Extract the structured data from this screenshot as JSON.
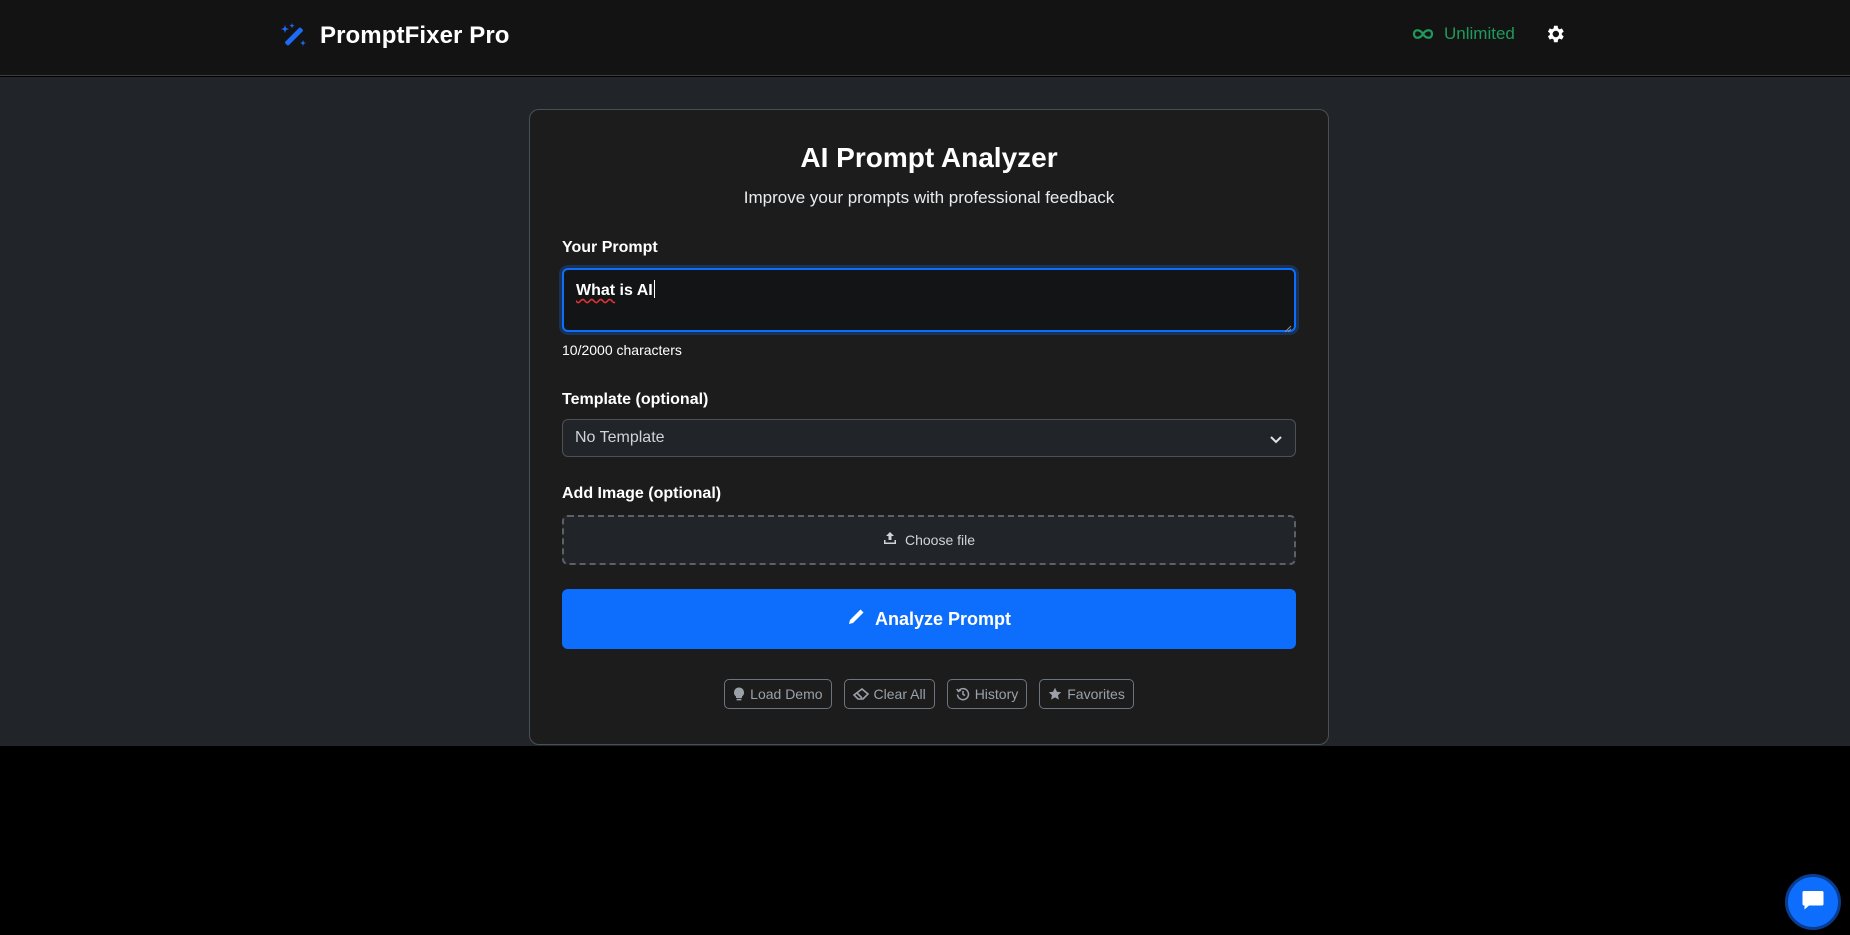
{
  "header": {
    "brand_name": "PromptFixer Pro",
    "plan_label": "Unlimited"
  },
  "card": {
    "title": "AI Prompt Analyzer",
    "subtitle": "Improve your prompts with professional feedback"
  },
  "prompt": {
    "label": "Your Prompt",
    "value_word1": "What",
    "value_rest": " is AI",
    "char_count": "10/2000 characters"
  },
  "template": {
    "label": "Template (optional)",
    "selected": "No Template"
  },
  "image": {
    "label": "Add Image (optional)",
    "choose_file": "Choose file"
  },
  "analyze_label": "Analyze Prompt",
  "actions": {
    "load_demo": "Load Demo",
    "clear_all": "Clear All",
    "history": "History",
    "favorites": "Favorites"
  },
  "colors": {
    "accent": "#0d6efd",
    "plan_green": "#1f9a5c",
    "page_bg": "#212529",
    "card_bg": "#1c1c1d"
  },
  "icons": [
    "magic-wand-icon",
    "infinity-icon",
    "gear-icon",
    "chevron-down-icon",
    "upload-icon",
    "pencil-icon",
    "lightbulb-icon",
    "eraser-icon",
    "history-icon",
    "star-icon",
    "chat-icon"
  ]
}
